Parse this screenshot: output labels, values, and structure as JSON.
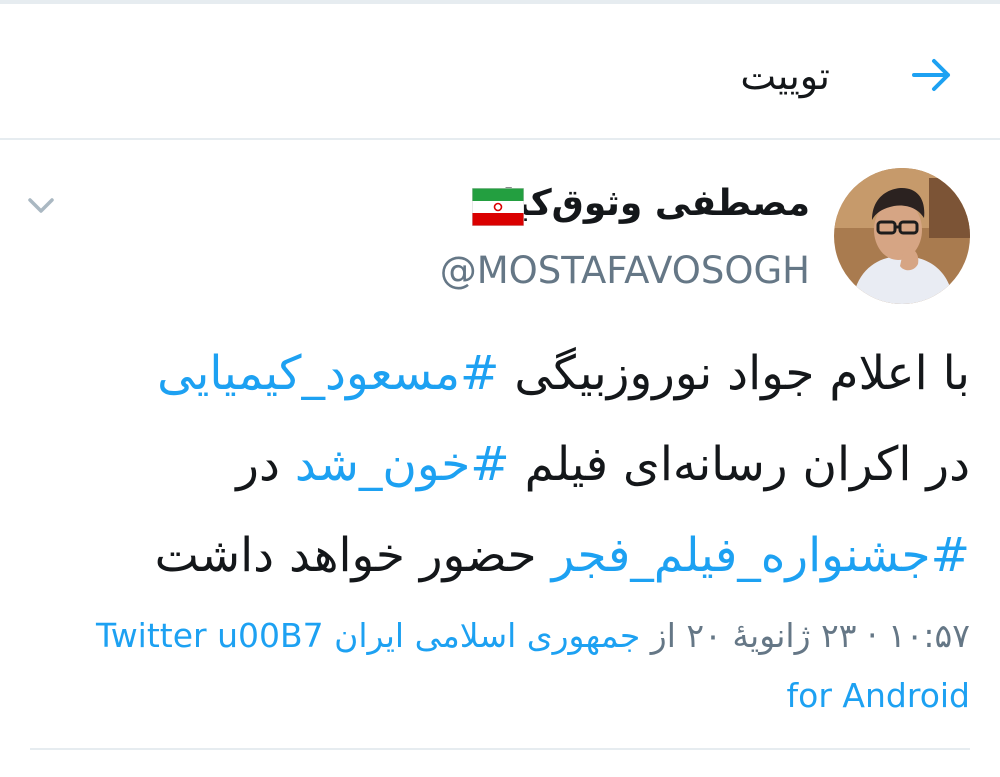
{
  "header": {
    "title": "توییت",
    "back_icon": "arrow-right-icon"
  },
  "author": {
    "display_name": "مصطفی وثوق‌کیا",
    "handle": "@MOSTAFAVOSOGH",
    "flag_icon": "iran-flag-icon"
  },
  "tweet": {
    "segments_line1": [
      "با اعلام جواد نوروزبیگی ",
      "#مسعود_کیمیایی"
    ],
    "segments_line2": [
      "در اکران رسانه‌ای فیلم ",
      "#خون_شد",
      " در"
    ],
    "segments_line3": [
      "#جشنواره_فیلم_فجر",
      " حضور خواهد داشت"
    ]
  },
  "meta": {
    "time_date": "۱۰:۵۷ · ۲۳ ژانویهٔ ۲۰ از ",
    "location": "جمهوری اسلامی ایران",
    "source_part1": "Twitter u00B7",
    "source_part2": "for Android"
  },
  "colors": {
    "accent": "#1da1f2",
    "text": "#14171a",
    "secondary": "#657786",
    "divider": "#e6ecf0"
  }
}
